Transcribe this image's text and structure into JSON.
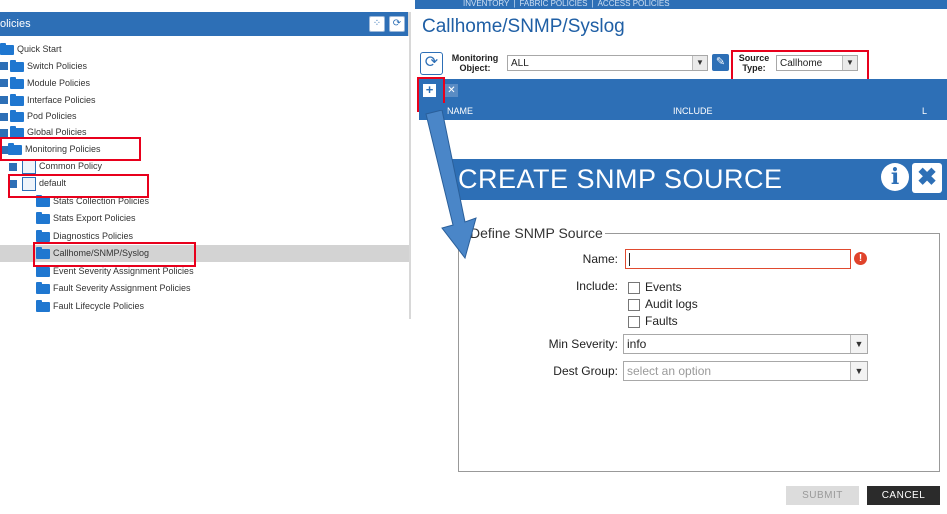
{
  "topnav": {
    "items": [
      "INVENTORY",
      "FABRIC POLICIES",
      "ACCESS POLICIES"
    ],
    "separator": "|"
  },
  "left_panel": {
    "title": "olicies",
    "tree": [
      {
        "label": "Quick Start"
      },
      {
        "label": "Switch Policies"
      },
      {
        "label": "Module Policies"
      },
      {
        "label": "Interface Policies"
      },
      {
        "label": "Pod Policies"
      },
      {
        "label": "Global Policies"
      },
      {
        "label": "Monitoring Policies"
      },
      {
        "label": "Common Policy"
      },
      {
        "label": "default"
      },
      {
        "label": "Stats Collection Policies"
      },
      {
        "label": "Stats Export Policies"
      },
      {
        "label": "Diagnostics Policies"
      },
      {
        "label": "Callhome/SNMP/Syslog"
      },
      {
        "label": "Event Severity Assignment Policies"
      },
      {
        "label": "Fault Severity Assignment Policies"
      },
      {
        "label": "Fault Lifecycle Policies"
      }
    ]
  },
  "main": {
    "title": "Callhome/SNMP/Syslog",
    "monitoring_object_label": "Monitoring Object:",
    "monitoring_object_value": "ALL",
    "source_type_label": "Source Type:",
    "source_type_value": "Callhome",
    "table_columns": [
      "NAME",
      "INCLUDE",
      "L"
    ]
  },
  "dialog": {
    "title": "CREATE SNMP SOURCE",
    "section_title": "Define SNMP Source",
    "name_label": "Name:",
    "include_label": "Include:",
    "include_options": [
      "Events",
      "Audit logs",
      "Faults"
    ],
    "min_severity_label": "Min Severity:",
    "min_severity_value": "info",
    "dest_group_label": "Dest Group:",
    "dest_group_placeholder": "select an option",
    "submit_label": "SUBMIT",
    "cancel_label": "CANCEL",
    "info_glyph": "i",
    "close_glyph": "✖",
    "error_glyph": "!"
  },
  "colors": {
    "accent": "#2d6fb6",
    "highlight": "#e8001c",
    "error": "#e0432b"
  }
}
